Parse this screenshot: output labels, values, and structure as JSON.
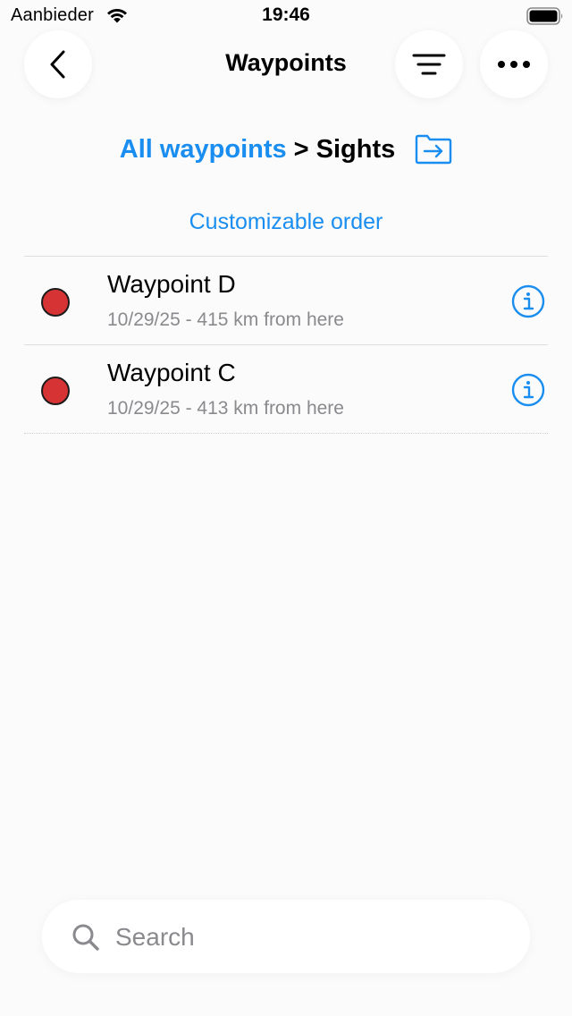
{
  "status_bar": {
    "carrier": "Aanbieder",
    "time": "19:46",
    "icons": [
      "wifi-icon",
      "battery-icon"
    ]
  },
  "nav": {
    "title": "Waypoints",
    "back_icon": "chevron-left-icon",
    "filter_icon": "sort-lines-icon",
    "more_icon": "ellipsis-icon"
  },
  "breadcrumb": {
    "root": "All waypoints",
    "separator": ">",
    "current": "Sights",
    "action_icon": "folder-move-icon"
  },
  "order_label": "Customizable order",
  "colors": {
    "accent": "#1a8ef0",
    "dot": "#d63434",
    "secondary_text": "#8a8a8e"
  },
  "waypoints": [
    {
      "name": "Waypoint D",
      "detail": "10/29/25 - 415 km from here",
      "icon": "red-dot-icon"
    },
    {
      "name": "Waypoint C",
      "detail": "10/29/25 - 413 km from here",
      "icon": "red-dot-icon"
    }
  ],
  "search": {
    "placeholder": "Search",
    "value": ""
  }
}
